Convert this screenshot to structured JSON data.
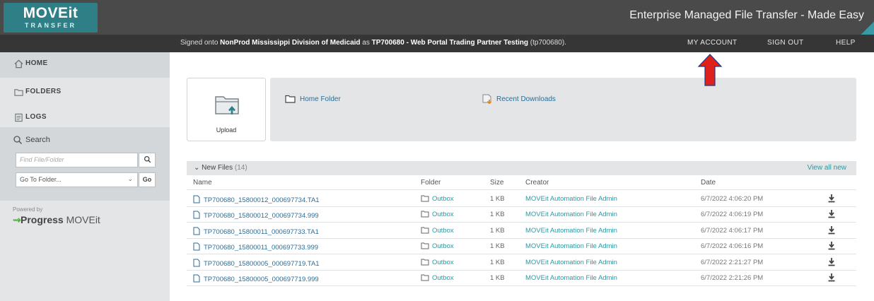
{
  "header": {
    "logo_main": "MOVEit",
    "logo_sub": "TRANSFER",
    "tagline": "Enterprise Managed File Transfer - Made Easy"
  },
  "signbar": {
    "prefix": "Signed onto ",
    "org": "NonProd Mississippi Division of Medicaid",
    "middle": " as ",
    "user": "TP700680 - Web Portal Trading Partner Testing",
    "suffix": " (tp700680).",
    "my_account": "MY ACCOUNT",
    "sign_out": "SIGN OUT",
    "help": "HELP"
  },
  "sidebar": {
    "items": [
      {
        "label": "HOME",
        "icon": "home-icon"
      },
      {
        "label": "FOLDERS",
        "icon": "folder-icon"
      },
      {
        "label": "LOGS",
        "icon": "logs-icon"
      }
    ],
    "search_label": "Search",
    "find_placeholder": "Find File/Folder",
    "goto_value": "Go To Folder...",
    "go_label": "Go",
    "powered_by": "Powered by",
    "brand": "Progress",
    "brand_product": " MOVEit"
  },
  "main": {
    "upload_label": "Upload",
    "home_folder": "Home Folder",
    "recent_downloads": "Recent Downloads",
    "new_files_label": "New Files",
    "new_files_count": "(14)",
    "view_all": "View all new",
    "columns": [
      "Name",
      "Folder",
      "Size",
      "Creator",
      "Date"
    ],
    "rows": [
      {
        "name": "TP700680_15800012_000697734.TA1",
        "folder": "Outbox",
        "size": "1 KB",
        "creator": "MOVEit Automation File Admin",
        "date": "6/7/2022 4:06:20 PM"
      },
      {
        "name": "TP700680_15800012_000697734.999",
        "folder": "Outbox",
        "size": "1 KB",
        "creator": "MOVEit Automation File Admin",
        "date": "6/7/2022 4:06:19 PM"
      },
      {
        "name": "TP700680_15800011_000697733.TA1",
        "folder": "Outbox",
        "size": "1 KB",
        "creator": "MOVEit Automation File Admin",
        "date": "6/7/2022 4:06:17 PM"
      },
      {
        "name": "TP700680_15800011_000697733.999",
        "folder": "Outbox",
        "size": "1 KB",
        "creator": "MOVEit Automation File Admin",
        "date": "6/7/2022 4:06:16 PM"
      },
      {
        "name": "TP700680_15800005_000697719.TA1",
        "folder": "Outbox",
        "size": "1 KB",
        "creator": "MOVEit Automation File Admin",
        "date": "6/7/2022 2:21:27 PM"
      },
      {
        "name": "TP700680_15800005_000697719.999",
        "folder": "Outbox",
        "size": "1 KB",
        "creator": "MOVEit Automation File Admin",
        "date": "6/7/2022 2:21:26 PM"
      }
    ]
  },
  "colors": {
    "header_bg": "#4a4a4a",
    "signbar_bg": "#363636",
    "logo_bg": "#2f7f87",
    "link": "#2a6e99",
    "teal_link": "#2a9aa3",
    "annotation_arrow": "#e0201b"
  }
}
